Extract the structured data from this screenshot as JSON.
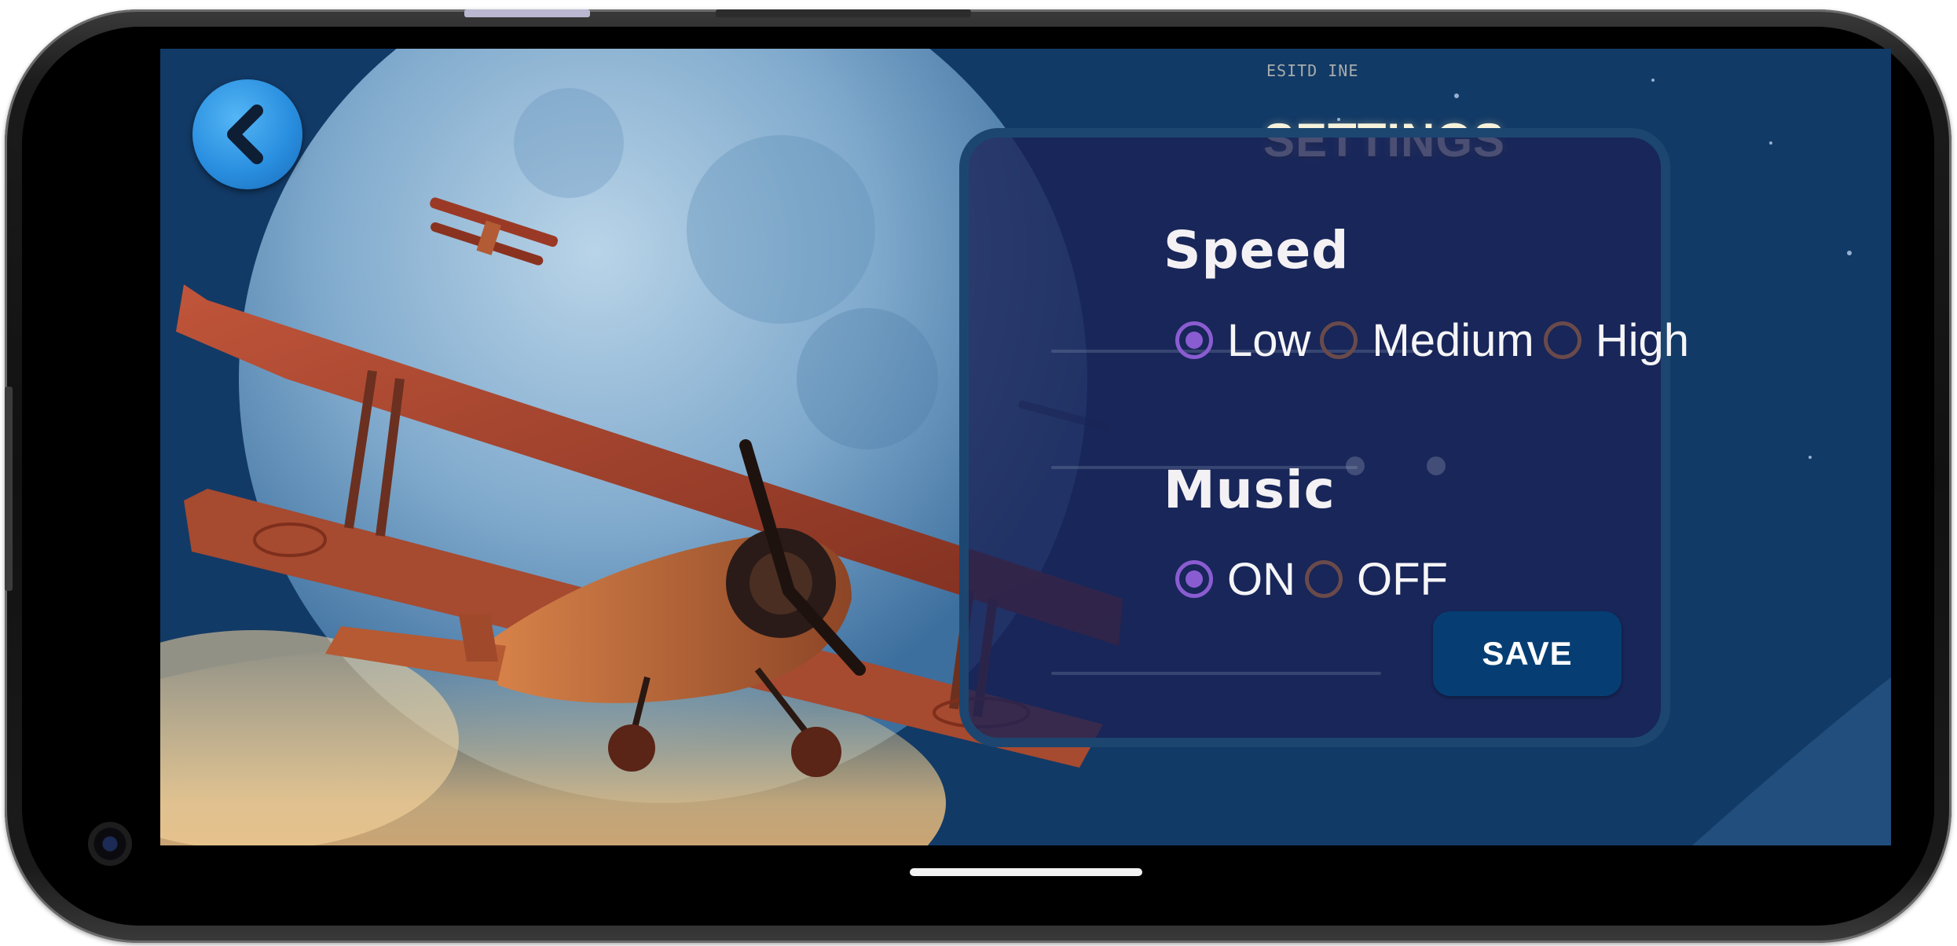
{
  "header": {
    "faded_caption": "ESITD INE",
    "title": "SETTINGS"
  },
  "back_button": {
    "icon": "chevron-left-icon",
    "color": "#2a8fe0"
  },
  "speed": {
    "title": "Speed",
    "options": [
      {
        "label": "Low",
        "checked": true
      },
      {
        "label": "Medium",
        "checked": false
      },
      {
        "label": "High",
        "checked": false
      }
    ]
  },
  "music": {
    "title": "Music",
    "options": [
      {
        "label": "ON",
        "checked": true
      },
      {
        "label": "OFF",
        "checked": false
      }
    ]
  },
  "save_button": {
    "label": "SAVE",
    "color": "#063e74"
  },
  "colors": {
    "panel_bg": "#192156",
    "panel_border": "#1c4670",
    "radio_checked": "#8a5cd1",
    "radio_unchecked": "#6a4a4a"
  }
}
